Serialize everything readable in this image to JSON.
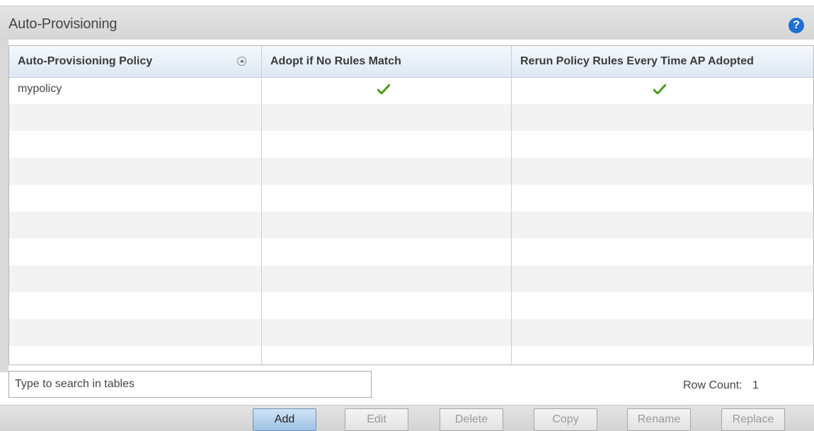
{
  "panel": {
    "title": "Auto-Provisioning",
    "help_icon": "question-circle-icon",
    "help_glyph": "?"
  },
  "table": {
    "columns": [
      {
        "label": "Auto-Provisioning Policy",
        "sort": "ascending"
      },
      {
        "label": "Adopt if No Rules Match"
      },
      {
        "label": "Rerun Policy Rules Every Time AP Adopted"
      }
    ],
    "rows": [
      {
        "policy": "mypolicy",
        "adopt_if_no_rules_match": true,
        "rerun_policy_rules": true
      }
    ],
    "check_color": "#4a9a1c"
  },
  "footer": {
    "search_placeholder": "Type to search in tables",
    "row_count_label": "Row Count:",
    "row_count_value": "1"
  },
  "buttons": {
    "add": "Add",
    "edit": "Edit",
    "delete": "Delete",
    "copy": "Copy",
    "rename": "Rename",
    "replace": "Replace"
  },
  "colors": {
    "accent": "#1f6fd1",
    "header_gradient_top": "#f5f9fd",
    "header_gradient_bottom": "#dde8f3"
  }
}
